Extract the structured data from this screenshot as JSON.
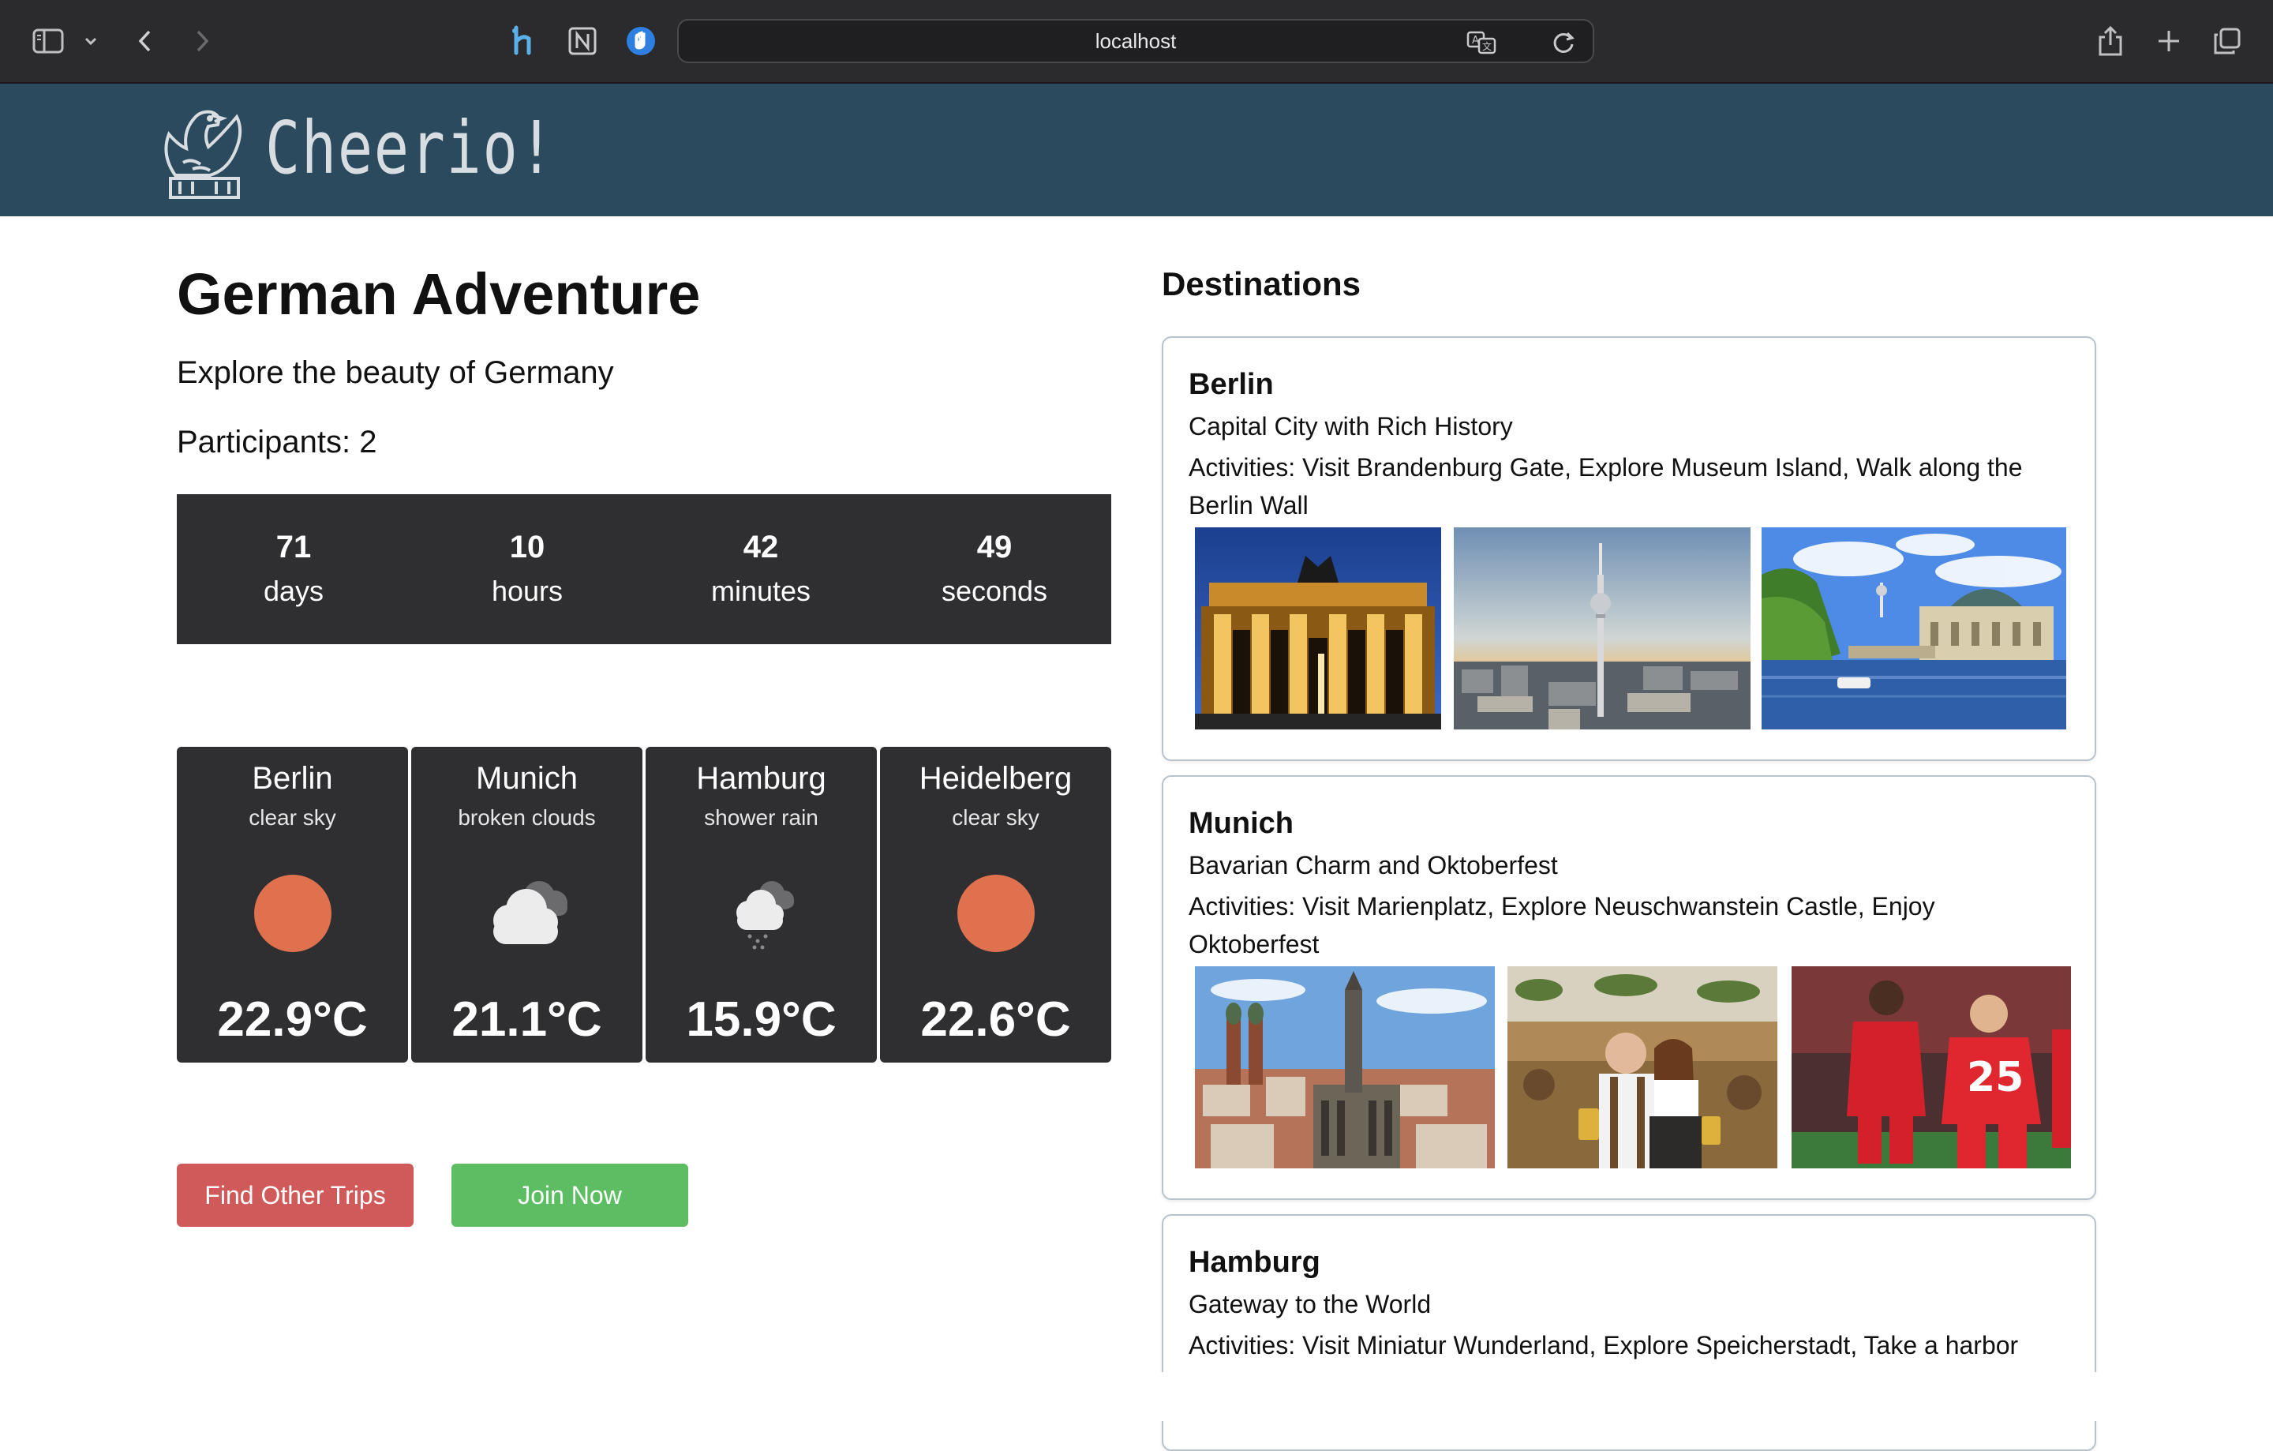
{
  "browser": {
    "url": "localhost"
  },
  "header": {
    "logo_text": "Cheerio!"
  },
  "trip": {
    "title": "German Adventure",
    "description": "Explore the beauty of Germany",
    "participants": "Participants: 2"
  },
  "countdown": [
    {
      "value": "71",
      "label": "days"
    },
    {
      "value": "10",
      "label": "hours"
    },
    {
      "value": "42",
      "label": "minutes"
    },
    {
      "value": "49",
      "label": "seconds"
    }
  ],
  "weather": [
    {
      "city": "Berlin",
      "condition": "clear sky",
      "temp": "22.9°C",
      "icon": "sun-icon"
    },
    {
      "city": "Munich",
      "condition": "broken clouds",
      "temp": "21.1°C",
      "icon": "cloud-icon"
    },
    {
      "city": "Hamburg",
      "condition": "shower rain",
      "temp": "15.9°C",
      "icon": "rain-cloud-icon"
    },
    {
      "city": "Heidelberg",
      "condition": "clear sky",
      "temp": "22.6°C",
      "icon": "sun-icon"
    }
  ],
  "buttons": {
    "find_other_trips": "Find Other Trips",
    "join_now": "Join Now"
  },
  "destinations": {
    "heading": "Destinations",
    "items": [
      {
        "name": "Berlin",
        "tagline": "Capital City with Rich History",
        "activities": "Activities: Visit Brandenburg Gate, Explore Museum Island, Walk along the Berlin Wall"
      },
      {
        "name": "Munich",
        "tagline": "Bavarian Charm and Oktoberfest",
        "activities": "Activities: Visit Marienplatz, Explore Neuschwanstein Castle, Enjoy Oktoberfest"
      },
      {
        "name": "Hamburg",
        "tagline": "Gateway to the World",
        "activities": "Activities: Visit Miniatur Wunderland, Explore Speicherstadt, Take a harbor"
      }
    ]
  },
  "colors": {
    "header_bg": "#2c4a5d",
    "panel_bg": "#2f2e30",
    "sun": "#e0714f",
    "button_red": "#d0595a",
    "button_green": "#5dbd63"
  }
}
